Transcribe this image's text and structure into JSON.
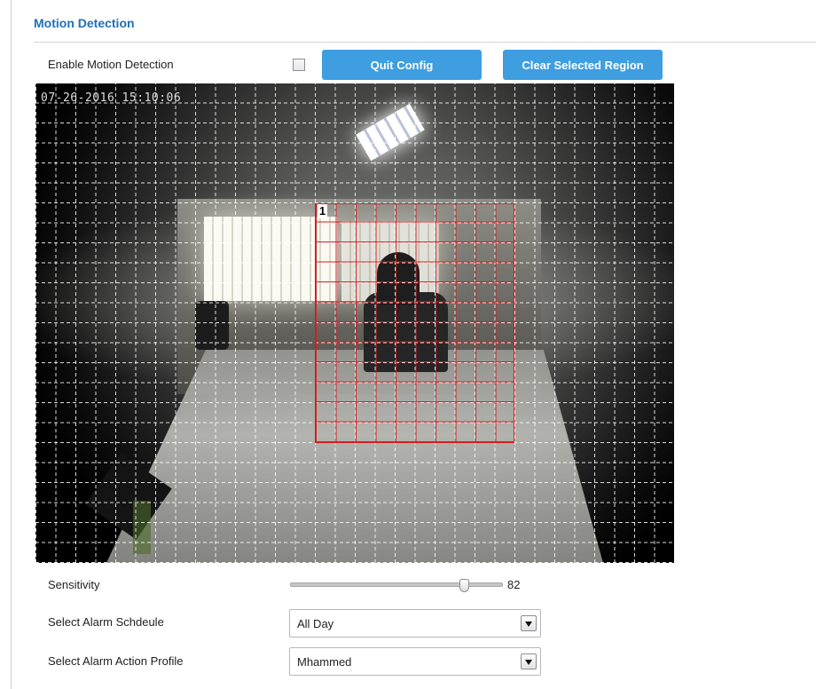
{
  "header": {
    "title": "Motion Detection"
  },
  "enable": {
    "label": "Enable Motion Detection",
    "checked": false
  },
  "buttons": {
    "quit": "Quit Config",
    "clear": "Clear Selected Region"
  },
  "video": {
    "timestamp": "07-26-2016 15:10:06",
    "region_number": "1",
    "grid_color": "#ffffff",
    "region_color": "#d61e1e"
  },
  "sensitivity": {
    "label": "Sensitivity",
    "value": 82,
    "value_text": "82",
    "max": 100
  },
  "schedule": {
    "label": "Select Alarm Schdeule",
    "selected": "All Day"
  },
  "action_profile": {
    "label": "Select Alarm Action Profile",
    "selected": "Mhammed"
  },
  "colors": {
    "accent": "#3e9ee0",
    "title": "#1f6fb8"
  }
}
